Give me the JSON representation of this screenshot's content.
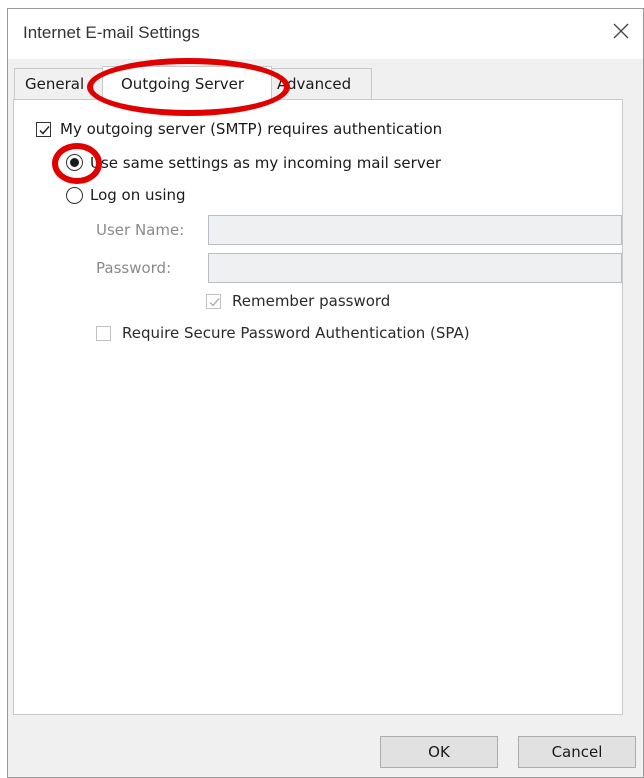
{
  "window": {
    "title": "Internet E-mail Settings",
    "close_icon": "close-icon"
  },
  "tabs": [
    {
      "label": "General",
      "active": false
    },
    {
      "label": "Outgoing Server",
      "active": true
    },
    {
      "label": "Advanced",
      "active": false
    }
  ],
  "auth": {
    "requires_auth_label": "My outgoing server (SMTP) requires authentication",
    "requires_auth_checked": true,
    "same_settings_label": "Use same settings as my incoming mail server",
    "same_settings_selected": true,
    "log_on_label": "Log on using",
    "log_on_selected": false,
    "username_label": "User Name:",
    "username_value": "",
    "password_label": "Password:",
    "password_value": "",
    "remember_label": "Remember password",
    "remember_checked": true,
    "spa_label": "Require Secure Password Authentication (SPA)",
    "spa_checked": false
  },
  "buttons": {
    "ok": "OK",
    "cancel": "Cancel"
  },
  "colors": {
    "annotation": "#e00000",
    "dialog_bg": "#f0f0f0"
  }
}
